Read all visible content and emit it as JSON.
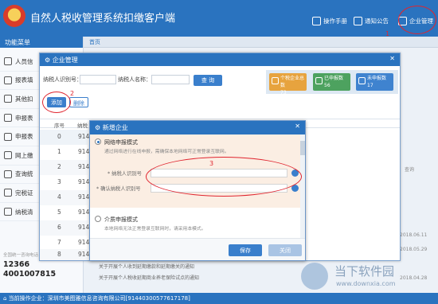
{
  "header": {
    "title": "自然人税收管理系统扣缴客户端",
    "manual": "操作手册",
    "notice": "通知公告",
    "corp_mgmt": "企业管理",
    "step1": "1"
  },
  "tabbar": {
    "home": "首页"
  },
  "sidebar": {
    "menu_title": "功能菜单",
    "items": [
      "人员信",
      "报表填",
      "其他扣",
      "申报表",
      "申报表",
      "网上缴",
      "查询统",
      "完税证",
      "纳税清"
    ],
    "hotline_label": "全国统一咨询电话",
    "phone1": "12366",
    "phone2": "4001007815"
  },
  "background": {
    "side_text": "查询",
    "date1": "2018.06.11",
    "date2": "2018.05.29",
    "date3": "2018.04.28",
    "notice1": "关于开展个人收到延期缴款和延期缴关的通知",
    "notice2": "关于开展个人税收延期商业养老保险试点的通知",
    "status": "当前操作企业：深圳市美图雅信息咨询有限公司[91440300577617178]"
  },
  "dialog": {
    "title": "企业管理",
    "taxpayer_id_label": "纳税人识别号：",
    "taxpayer_name_label": "纳税人名称：",
    "query_button": "查 询",
    "add_button": "添加",
    "delete_button": "删除",
    "step2": "2",
    "stats": [
      {
        "label": "个税企业总数",
        "value": "73",
        "color": "#e7a33e"
      },
      {
        "label": "已申报数",
        "value": "56",
        "color": "#4da25f"
      },
      {
        "label": "未申报数",
        "value": "17",
        "color": "#3f83cf"
      }
    ],
    "columns": [
      "序号",
      "纳税"
    ],
    "rows": [
      {
        "no": "0",
        "code": "914"
      },
      {
        "no": "1",
        "code": "914"
      },
      {
        "no": "2",
        "code": "914"
      },
      {
        "no": "3",
        "code": "914"
      },
      {
        "no": "4",
        "code": "914"
      },
      {
        "no": "5",
        "code": "914"
      },
      {
        "no": "6",
        "code": "914"
      },
      {
        "no": "7",
        "code": "914"
      },
      {
        "no": "8",
        "code": "914"
      }
    ]
  },
  "new_company": {
    "title": "新增企业",
    "opt_network": "网络申报模式",
    "opt_network_hint": "通过网络进行在线申报，需确保本地网络可正常登录互联网。",
    "field_taxpayer_id": "* 纳税人识别号",
    "field_confirm_id": "* 确认纳税人识别号",
    "step3": "3",
    "opt_media": "介质申报模式",
    "opt_media_hint": "本地网络无法正常登录互联网时，请采用本模式。",
    "save_button": "保存",
    "close_button": "关闭"
  },
  "watermark": {
    "cn": "当下软件园",
    "url": "www.downxia.com"
  }
}
